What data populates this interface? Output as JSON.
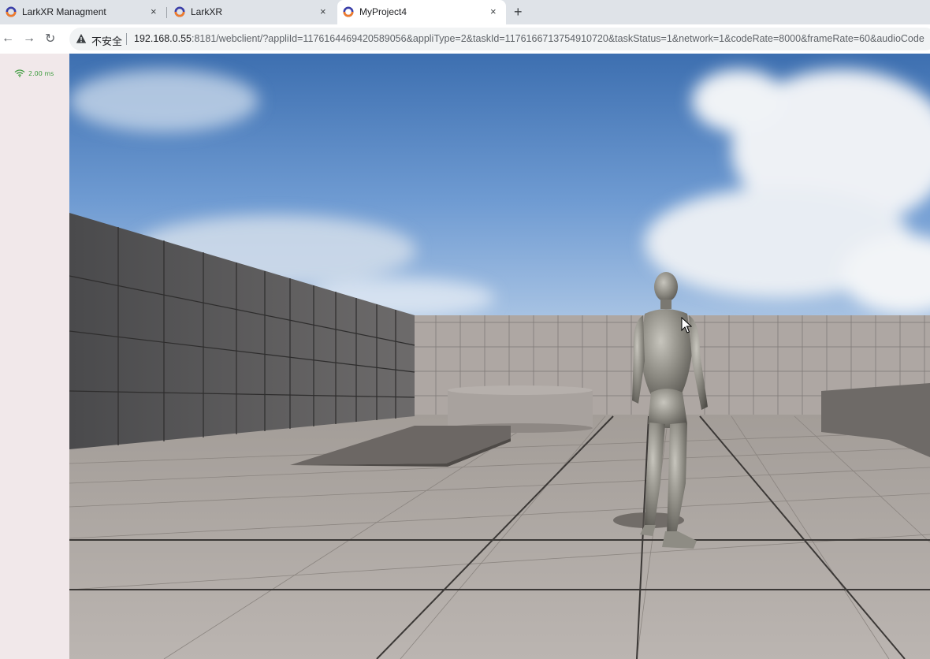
{
  "tabs": [
    {
      "title": "LarkXR Managment",
      "close": "×",
      "active": false
    },
    {
      "title": "LarkXR",
      "close": "×",
      "active": false
    },
    {
      "title": "MyProject4",
      "close": "×",
      "active": true
    }
  ],
  "new_tab": "+",
  "nav": {
    "back": "←",
    "forward": "→",
    "reload": "↻"
  },
  "address": {
    "security_label": "不安全",
    "host": "192.168.0.55",
    "rest": ":8181/webclient/?appliId=1176164469420589056&appliType=2&taskId=1176166713754910720&taskStatus=1&network=1&codeRate=8000&frameRate=60&audioCode"
  },
  "network": {
    "latency": "2.00 ms"
  },
  "colors": {
    "latency_green": "#3d9b3d",
    "tabbar_bg": "#dfe3e8",
    "side_panel": "#f1e8ea",
    "favicon_orange": "#f07b2a",
    "favicon_blue": "#3b3fa8"
  },
  "icons": [
    "larkxr-favicon",
    "close-icon",
    "plus-icon",
    "back-arrow-icon",
    "forward-arrow-icon",
    "reload-icon",
    "warning-icon",
    "wifi-icon",
    "mouse-cursor-icon"
  ]
}
